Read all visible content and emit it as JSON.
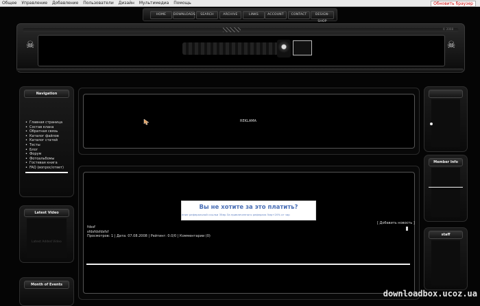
{
  "topbar": {
    "menu": [
      "Общее",
      "Управление",
      "Добавление",
      "Пользователи",
      "Дизайн",
      "Мультимедиа",
      "Помощь"
    ],
    "refresh": "Обновить браузер"
  },
  "nav": [
    "HOME",
    "DOWNLOADS",
    "SEARCH",
    "ARCHIVE",
    "LINKS",
    "ACCOUNT",
    "CONTACT",
    "DESIGN-SHOP"
  ],
  "header": {
    "copyright": "© 2008"
  },
  "sidebar_left": {
    "navigation": {
      "title": "Navigation",
      "items": [
        "Главная страница",
        "Состав клана",
        "Обратная связь",
        "Каталог файлов",
        "Каталог статей",
        "Тесты",
        "Блог",
        "Форум",
        "Фотоальбомы",
        "Гостевая книга",
        "FAQ (вопрос/ответ)"
      ]
    },
    "latest_video": {
      "title": "Latest Video",
      "placeholder": "Latest Added Video"
    },
    "month_events": {
      "title": "Month of Events"
    }
  },
  "sidebar_right": {
    "member_info": {
      "title": "Member Info"
    },
    "staff": {
      "title": "staff"
    }
  },
  "main": {
    "rekl": "REKLAMA",
    "ad": {
      "headline": "Вы не хотите за это платить?",
      "subline": "ение реферальной ссылки 35мр     За привлеченного реферала 5мр+20% от зар"
    },
    "add_news": "[ Добавить новость ]",
    "news": {
      "title": "fdssf",
      "body": "sfdsfdsfdsfsf",
      "meta": "Просмотров: 1 | Дата: 07.08.2008 | Рейтинг: 0.0/0 | Комментарии (0)"
    }
  },
  "watermark": "downloadbox.ucoz.ua"
}
